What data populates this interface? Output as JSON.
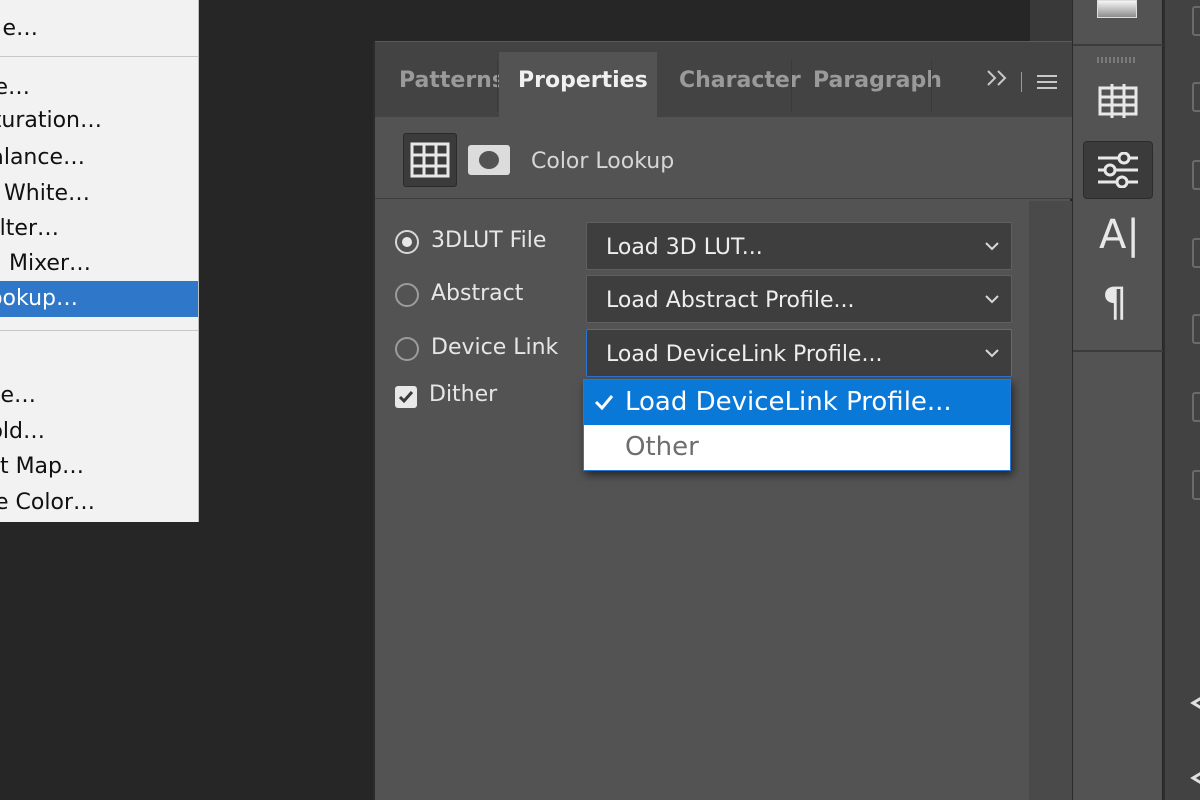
{
  "left_menu": {
    "items": [
      {
        "label": "e…",
        "selected": false
      },
      {
        "label": "e…",
        "selected": false
      },
      {
        "label": "turation…",
        "selected": false
      },
      {
        "label": "alance…",
        "selected": false
      },
      {
        "label": "d White…",
        "selected": false
      },
      {
        "label": "ilter…",
        "selected": false
      },
      {
        "label": "l Mixer…",
        "selected": false
      },
      {
        "label": "ookup…",
        "selected": true
      },
      {
        "label": "e…",
        "selected": false
      },
      {
        "label": "old…",
        "selected": false
      },
      {
        "label": "t Map…",
        "selected": false
      },
      {
        "label": "e Color…",
        "selected": false
      }
    ]
  },
  "panel": {
    "tabs": [
      {
        "label": "Patterns",
        "active": false
      },
      {
        "label": "Properties",
        "active": true
      },
      {
        "label": "Character",
        "active": false
      },
      {
        "label": "Paragraph",
        "active": false
      }
    ],
    "more_icon": "double-chevron-right-icon",
    "menu_icon": "hamburger-menu-icon",
    "header": {
      "title": "Color Lookup",
      "icons": [
        "adjustment-grid-icon",
        "layer-mask-icon"
      ]
    },
    "options": [
      {
        "label": "3DLUT File",
        "checked": true,
        "select_value": "Load 3D LUT..."
      },
      {
        "label": "Abstract",
        "checked": false,
        "select_value": "Load Abstract Profile..."
      },
      {
        "label": "Device Link",
        "checked": false,
        "select_value": "Load DeviceLink Profile..."
      }
    ],
    "dither": {
      "label": "Dither",
      "checked": true
    },
    "dropdown": {
      "options": [
        {
          "label": "Load DeviceLink Profile...",
          "selected": true
        },
        {
          "label": "Other",
          "selected": false
        }
      ]
    }
  },
  "toolbar": {
    "icons": [
      "gradient-swatch-icon",
      "grid-adjust-icon",
      "adjustments-sliders-icon",
      "character-text-icon",
      "paragraph-icon"
    ],
    "active_icon": "adjustments-sliders-icon",
    "text_icon_glyph": "A|",
    "paragraph_glyph": "¶"
  },
  "colors": {
    "accent": "#0a78d7",
    "menu_selection": "#2e77c9",
    "panel_bg": "#535353",
    "tab_bg": "#434343"
  }
}
